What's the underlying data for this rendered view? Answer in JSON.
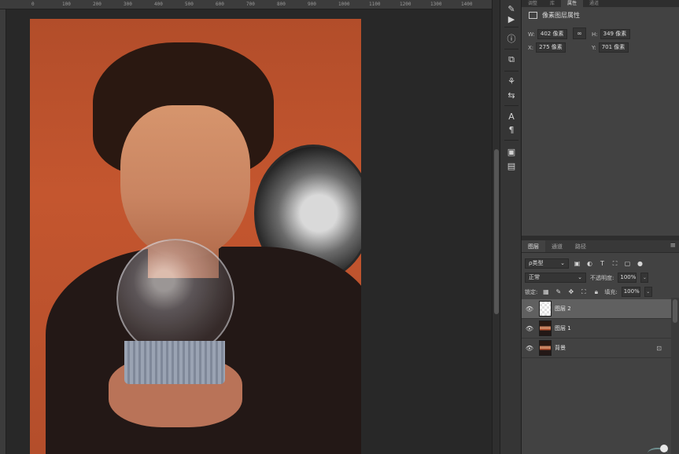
{
  "ruler": {
    "ticks": [
      "0",
      "100",
      "200",
      "300",
      "400",
      "500",
      "600",
      "700",
      "800",
      "900",
      "1000",
      "1100",
      "1200",
      "1300",
      "1400"
    ]
  },
  "right_panel": {
    "top_tabs": [
      "调整",
      "库",
      "属性",
      "通道"
    ],
    "properties": {
      "title": "像素图层属性",
      "w_label": "W:",
      "w_value": "402 像素",
      "h_label": "H:",
      "h_value": "349 像素",
      "x_label": "X:",
      "x_value": "275 像素",
      "y_label": "Y:",
      "y_value": "701 像素",
      "link_glyph": "∞"
    },
    "layers_panel": {
      "tabs": [
        "图层",
        "通道",
        "路径"
      ],
      "filter_kind": "ρ类型",
      "blend_mode": "正常",
      "opacity_label": "不透明度:",
      "opacity_value": "100%",
      "lock_label": "锁定:",
      "fill_label": "填充:",
      "fill_value": "100%",
      "layers": [
        {
          "name": "图层 2",
          "selected": true,
          "thumb": "transparent"
        },
        {
          "name": "图层 1",
          "selected": false,
          "thumb": "image"
        },
        {
          "name": "背景",
          "selected": false,
          "thumb": "image",
          "locked": true
        }
      ]
    }
  },
  "colors": {
    "panel_bg": "#424242",
    "selected_layer": "#606060",
    "photo_background": "#c4562f"
  }
}
